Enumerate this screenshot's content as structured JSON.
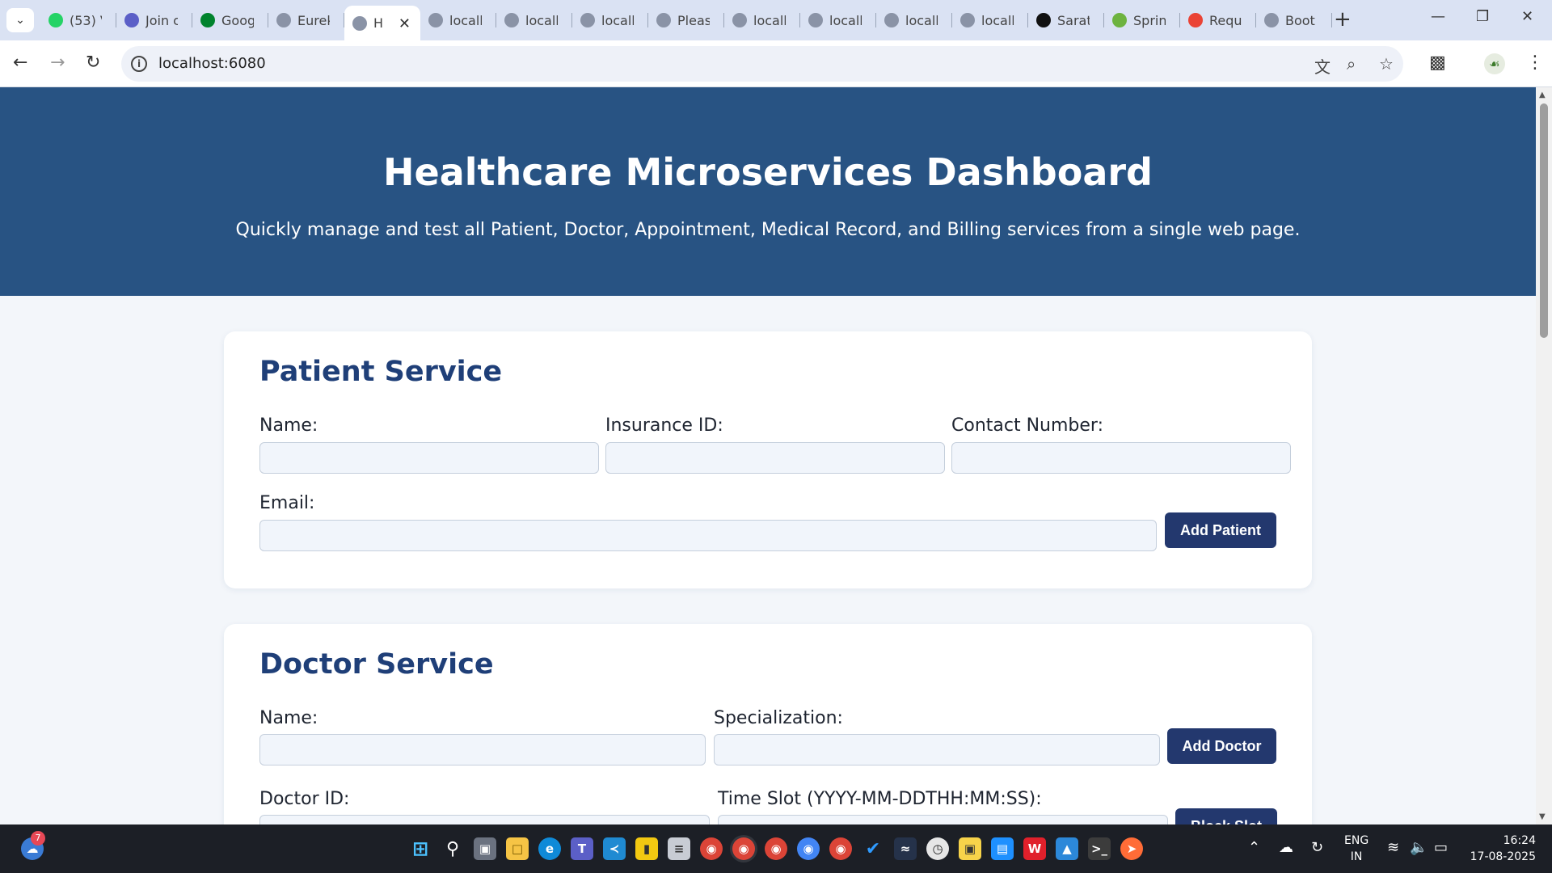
{
  "browser": {
    "tabs": [
      {
        "title": "(53) V",
        "favicon": "whatsapp-icon",
        "color": "#25d366"
      },
      {
        "title": "Join c",
        "favicon": "teams-icon",
        "color": "#5b5fc7"
      },
      {
        "title": "Goog",
        "favicon": "google-meet-icon",
        "color": "#00832d"
      },
      {
        "title": "Eurek",
        "favicon": "globe-icon",
        "color": "#8a93a6"
      },
      {
        "title": "H",
        "favicon": "globe-icon",
        "color": "#8a93a6",
        "active": true
      },
      {
        "title": "locall",
        "favicon": "globe-icon",
        "color": "#8a93a6"
      },
      {
        "title": "locall",
        "favicon": "globe-icon",
        "color": "#8a93a6"
      },
      {
        "title": "locall",
        "favicon": "globe-icon",
        "color": "#8a93a6"
      },
      {
        "title": "Pleas",
        "favicon": "globe-icon",
        "color": "#8a93a6"
      },
      {
        "title": "locall",
        "favicon": "globe-icon",
        "color": "#8a93a6"
      },
      {
        "title": "locall",
        "favicon": "globe-icon",
        "color": "#8a93a6"
      },
      {
        "title": "locall",
        "favicon": "globe-icon",
        "color": "#8a93a6"
      },
      {
        "title": "locall",
        "favicon": "globe-icon",
        "color": "#8a93a6"
      },
      {
        "title": "Sarat",
        "favicon": "github-icon",
        "color": "#111111"
      },
      {
        "title": "Sprin",
        "favicon": "spring-icon",
        "color": "#6db33f"
      },
      {
        "title": "Requ",
        "favicon": "gmail-icon",
        "color": "#ea4335"
      },
      {
        "title": "Boot",
        "favicon": "globe-icon",
        "color": "#8a93a6"
      }
    ],
    "url": "localhost:6080"
  },
  "hero": {
    "title": "Healthcare Microservices Dashboard",
    "subtitle": "Quickly manage and test all Patient, Doctor, Appointment, Medical Record, and Billing services from a single web page.",
    "bg_color": "#285383"
  },
  "patient": {
    "heading": "Patient Service",
    "name_label": "Name:",
    "insurance_label": "Insurance ID:",
    "contact_label": "Contact Number:",
    "email_label": "Email:",
    "add_button": "Add Patient"
  },
  "doctor": {
    "heading": "Doctor Service",
    "name_label": "Name:",
    "specialization_label": "Specialization:",
    "add_button": "Add Doctor",
    "doctor_id_label": "Doctor ID:",
    "time_slot_label": "Time Slot (YYYY-MM-DDTHH:MM:SS):",
    "block_button": "Block Slot"
  },
  "taskbar": {
    "notification_count": "7",
    "lang_line1": "ENG",
    "lang_line2": "IN",
    "time": "16:24",
    "date": "17-08-2025"
  },
  "colors": {
    "accent_button": "#23386e",
    "heading": "#1f3f78"
  }
}
